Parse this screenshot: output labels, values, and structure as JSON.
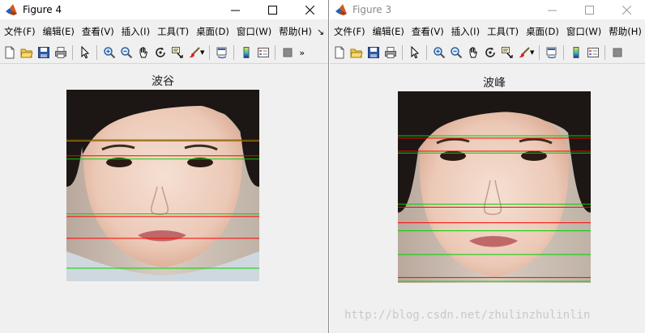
{
  "window_left": {
    "title": "Figure 4",
    "menu": [
      "文件(F)",
      "编辑(E)",
      "查看(V)",
      "插入(I)",
      "工具(T)",
      "桌面(D)",
      "窗口(W)",
      "帮助(H)"
    ],
    "menu_overflow": "↘",
    "axes_title": "波谷",
    "lines": {
      "green_y": [
        0.268,
        0.362,
        0.648,
        0.932
      ],
      "red_y": [
        0.262,
        0.345,
        0.662,
        0.776
      ],
      "green_color": "#00d000",
      "red_color": "#ff0000"
    }
  },
  "window_right": {
    "title": "Figure 3",
    "menu": [
      "文件(F)",
      "编辑(E)",
      "查看(V)",
      "插入(I)",
      "工具(T)",
      "桌面(D)",
      "窗口(W)",
      "帮助(H)"
    ],
    "axes_title": "波峰",
    "lines": {
      "green_y": [
        0.232,
        0.322,
        0.589,
        0.728,
        0.852,
        0.992
      ],
      "red_y": [
        0.244,
        0.312,
        0.605,
        0.686,
        0.972
      ],
      "green_color": "#00d000",
      "red_color": "#ff0000"
    }
  },
  "toolbar_icons": [
    "new-file-icon",
    "open-folder-icon",
    "save-icon",
    "print-icon",
    "pointer-icon",
    "zoom-in-icon",
    "zoom-out-icon",
    "pan-hand-icon",
    "rotate-3d-icon",
    "data-cursor-icon",
    "brush-icon",
    "link-plot-icon",
    "colorbar-icon",
    "legend-icon",
    "hide-tools-icon"
  ],
  "watermark": "http://blog.csdn.net/zhulinzhulinlin",
  "colors": {
    "window_bg": "#f0f0f0",
    "titlebar_bg": "#ffffff"
  }
}
